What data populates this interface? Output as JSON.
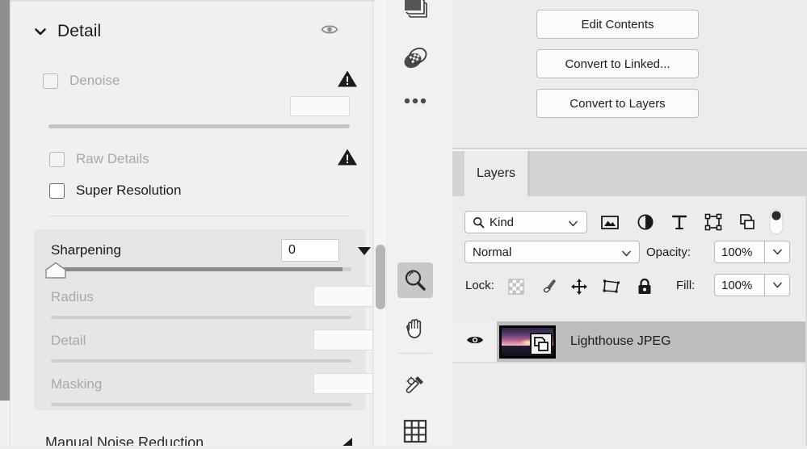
{
  "camera_raw_detail_panel": {
    "section_title": "Detail",
    "collapse_icon": "chevron-down-icon",
    "visibility_icon": "eye-icon",
    "denoise": {
      "label": "Denoise",
      "checked": false,
      "enabled": false,
      "warning_icon": "warning-triangle-icon",
      "value": ""
    },
    "raw_details": {
      "label": "Raw Details",
      "checked": false,
      "enabled": false,
      "warning_icon": "warning-triangle-icon"
    },
    "super_resolution": {
      "label": "Super Resolution",
      "checked": false,
      "enabled": true
    },
    "sharpening": {
      "label": "Sharpening",
      "value": "0",
      "expand_icon": "triangle-down-icon",
      "slider_percent": 0,
      "sub_sliders": [
        {
          "label": "Radius",
          "value": "",
          "enabled": false
        },
        {
          "label": "Detail",
          "value": "",
          "enabled": false
        },
        {
          "label": "Masking",
          "value": "",
          "enabled": false
        }
      ]
    },
    "manual_noise_reduction": {
      "label": "Manual Noise Reduction",
      "expand_icon": "triangle-left-icon"
    }
  },
  "tool_strip": {
    "tools": [
      {
        "name": "stack-layers-icon",
        "label": "Stack",
        "selected": false
      },
      {
        "name": "healing-patch-icon",
        "label": "Healing",
        "selected": false
      },
      {
        "name": "more-options-icon",
        "label": "More",
        "selected": false
      },
      {
        "name": "zoom-tool-icon",
        "label": "Zoom",
        "selected": true
      },
      {
        "name": "hand-tool-icon",
        "label": "Hand",
        "selected": false
      },
      {
        "name": "eyedropper-tool-icon",
        "label": "Eyedropper",
        "selected": false
      },
      {
        "name": "grid-tool-icon",
        "label": "Grid",
        "selected": false
      }
    ]
  },
  "properties_panel": {
    "buttons": [
      {
        "label": "Edit Contents"
      },
      {
        "label": "Convert to Linked..."
      },
      {
        "label": "Convert to Layers"
      }
    ]
  },
  "layers_panel": {
    "tab_label": "Layers",
    "filter": {
      "search_icon": "search-icon",
      "kind_label": "Kind",
      "caret_icon": "chevron-down-icon",
      "type_filters": [
        {
          "name": "pixel-layer-filter-icon",
          "label": "Pixel layers"
        },
        {
          "name": "adjustment-layer-filter-icon",
          "label": "Adjustment layers"
        },
        {
          "name": "type-layer-filter-icon",
          "label": "Type layers"
        },
        {
          "name": "shape-layer-filter-icon",
          "label": "Shape layers"
        },
        {
          "name": "smart-object-filter-icon",
          "label": "Smart objects"
        }
      ],
      "toggle_on": true
    },
    "blend_mode": {
      "label": "Normal",
      "caret_icon": "chevron-down-icon"
    },
    "opacity": {
      "label": "Opacity:",
      "value": "100%",
      "stepper_icon": "chevron-down-icon"
    },
    "lock": {
      "label": "Lock:",
      "icons": [
        {
          "name": "lock-transparency-icon",
          "label": "Lock transparent pixels"
        },
        {
          "name": "lock-image-brush-icon",
          "label": "Lock image pixels"
        },
        {
          "name": "lock-position-move-icon",
          "label": "Lock position"
        },
        {
          "name": "lock-artboard-nesting-icon",
          "label": "Prevent auto-nesting"
        },
        {
          "name": "lock-all-padlock-icon",
          "label": "Lock all"
        }
      ]
    },
    "fill": {
      "label": "Fill:",
      "value": "100%",
      "stepper_icon": "chevron-down-icon"
    },
    "layers": [
      {
        "name": "Lighthouse JPEG",
        "visible": true,
        "visibility_icon": "eye-icon",
        "selected": true,
        "smart_object_badge_icon": "smart-object-badge-icon"
      }
    ]
  },
  "colors": {
    "panel_bg": "#f0f0f0",
    "right_bg": "#ececec",
    "group_bg": "#e6e6e6",
    "selected_row": "#bdbdbd",
    "tab_bar": "#d4d4d4",
    "selected_tool": "#c8c8c8",
    "disabled_text": "#a8a8a8",
    "text": "#1b1b1b"
  }
}
